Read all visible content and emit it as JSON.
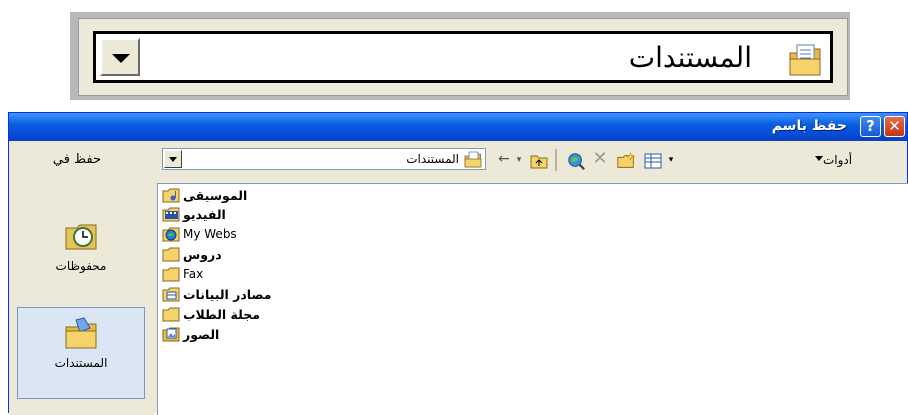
{
  "callout": {
    "folder_text": "المستندات"
  },
  "window": {
    "title": "حفظ باسم",
    "help_glyph": "?",
    "close_glyph": "✕"
  },
  "toolbar": {
    "save_in_label": "حفظ في",
    "current_folder": "المستندات",
    "tools_label": "أدوات"
  },
  "places": [
    {
      "label": "محفوظات",
      "icon": "history-folder-icon"
    },
    {
      "label": "المستندات",
      "icon": "documents-folder-icon",
      "selected": true
    }
  ],
  "items": [
    {
      "name": "الموسيقى",
      "icon": "music-folder-icon",
      "rtl": true
    },
    {
      "name": "الفيديو",
      "icon": "video-folder-icon",
      "rtl": true
    },
    {
      "name": "My Webs",
      "icon": "webs-folder-icon",
      "rtl": false
    },
    {
      "name": "دروس",
      "icon": "folder-icon",
      "rtl": true
    },
    {
      "name": "Fax",
      "icon": "folder-icon",
      "rtl": false
    },
    {
      "name": "مصادر البيانات",
      "icon": "data-sources-folder-icon",
      "rtl": true
    },
    {
      "name": "مجلة الطلاب",
      "icon": "folder-icon",
      "rtl": true
    },
    {
      "name": "الصور",
      "icon": "pictures-folder-icon",
      "rtl": true
    }
  ],
  "colors": {
    "titlebar": "#0a5fe0",
    "folder": "#f5d36a",
    "window_bg": "#ece9d8"
  }
}
